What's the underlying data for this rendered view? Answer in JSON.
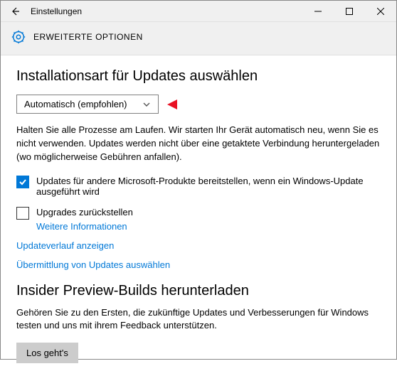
{
  "titlebar": {
    "title": "Einstellungen"
  },
  "header": {
    "crumb": "ERWEITERTE OPTIONEN"
  },
  "main": {
    "heading": "Installationsart für Updates auswählen",
    "select_value": "Automatisch (empfohlen)",
    "description": "Halten Sie alle Prozesse am Laufen. Wir starten Ihr Gerät automatisch neu, wenn Sie es nicht verwenden. Updates werden nicht über eine getaktete Verbindung heruntergeladen (wo möglicherweise Gebühren anfallen).",
    "check1_label": "Updates für andere Microsoft-Produkte bereitstellen, wenn ein Windows-Update ausgeführt wird",
    "check2_label": "Upgrades zurückstellen",
    "check2_more": "Weitere Informationen",
    "link_history": "Updateverlauf anzeigen",
    "link_delivery": "Übermittlung von Updates auswählen",
    "insider_heading": "Insider Preview-Builds herunterladen",
    "insider_desc": "Gehören Sie zu den Ersten, die zukünftige Updates und Verbesserungen für Windows testen und uns mit ihrem Feedback unterstützen.",
    "insider_button": "Los geht's"
  }
}
